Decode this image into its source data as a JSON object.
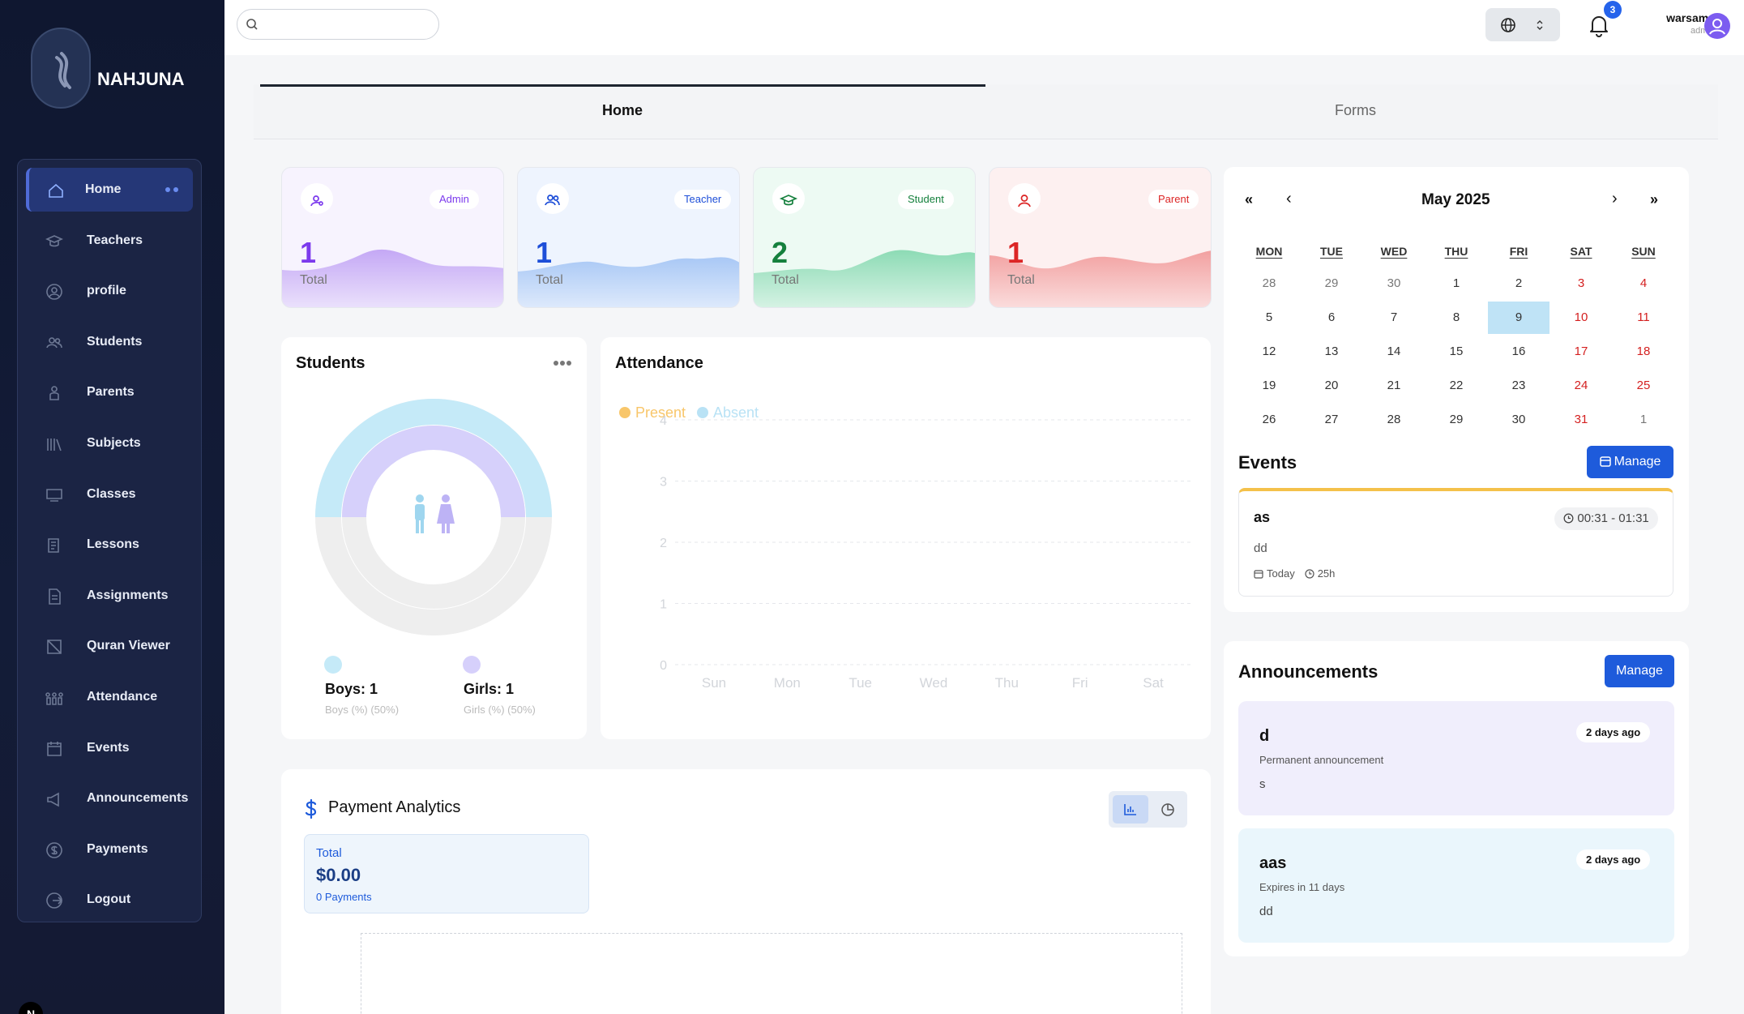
{
  "brand": {
    "name": "NAHJUNA"
  },
  "sidebar": {
    "items": [
      {
        "label": "Home",
        "icon": "home-icon"
      },
      {
        "label": "Teachers",
        "icon": "graduation-cap-icon"
      },
      {
        "label": "profile",
        "icon": "user-circle-icon"
      },
      {
        "label": "Students",
        "icon": "users-icon"
      },
      {
        "label": "Parents",
        "icon": "parent-icon"
      },
      {
        "label": "Subjects",
        "icon": "books-icon"
      },
      {
        "label": "Classes",
        "icon": "classroom-icon"
      },
      {
        "label": "Lessons",
        "icon": "notebook-icon"
      },
      {
        "label": "Assignments",
        "icon": "document-icon"
      },
      {
        "label": "Quran Viewer",
        "icon": "book-icon"
      },
      {
        "label": "Attendance",
        "icon": "attendance-icon"
      },
      {
        "label": "Events",
        "icon": "calendar-icon"
      },
      {
        "label": "Announcements",
        "icon": "megaphone-icon"
      },
      {
        "label": "Payments",
        "icon": "dollar-icon"
      },
      {
        "label": "Logout",
        "icon": "logout-icon"
      }
    ]
  },
  "corner_badge": "N",
  "topbar": {
    "search_placeholder": "",
    "notif_count": "3",
    "user_name": "warsame",
    "user_role": "admin"
  },
  "tabs": [
    {
      "label": "Home"
    },
    {
      "label": "Forms"
    }
  ],
  "stats": [
    {
      "role": "Admin",
      "value": "1",
      "total_label": "Total",
      "color": "#7c3aed"
    },
    {
      "role": "Teacher",
      "value": "1",
      "total_label": "Total",
      "color": "#1d4ed8"
    },
    {
      "role": "Student",
      "value": "2",
      "total_label": "Total",
      "color": "#15803d"
    },
    {
      "role": "Parent",
      "value": "1",
      "total_label": "Total",
      "color": "#dc2626"
    }
  ],
  "students": {
    "title": "Students",
    "boys": {
      "label": "Boys: 1",
      "sub": "Boys (%) (50%)",
      "value": 1,
      "color": "#c5eaf8"
    },
    "girls": {
      "label": "Girls: 1",
      "sub": "Girls (%) (50%)",
      "value": 1,
      "color": "#d6d0fb"
    }
  },
  "chart_data": {
    "type": "line",
    "title": "Attendance",
    "x": [
      "Sun",
      "Mon",
      "Tue",
      "Wed",
      "Thu",
      "Fri",
      "Sat"
    ],
    "yticks": [
      "0",
      "1",
      "2",
      "3",
      "4"
    ],
    "ylim": [
      0,
      4
    ],
    "grid": true,
    "legend_placement": "top-left",
    "series": [
      {
        "name": "Present",
        "color": "#f8c66a",
        "values": []
      },
      {
        "name": "Absent",
        "color": "#b9e2f5",
        "values": []
      }
    ]
  },
  "calendar": {
    "month": "May 2025",
    "nav": {
      "prev_year": "«",
      "prev": "‹",
      "next": "›",
      "next_year": "»"
    },
    "weekdays": [
      "MON",
      "TUE",
      "WED",
      "THU",
      "FRI",
      "SAT",
      "SUN"
    ],
    "weeks": [
      [
        "28",
        "29",
        "30",
        "1",
        "2",
        "3",
        "4"
      ],
      [
        "5",
        "6",
        "7",
        "8",
        "9",
        "10",
        "11"
      ],
      [
        "12",
        "13",
        "14",
        "15",
        "16",
        "17",
        "18"
      ],
      [
        "19",
        "20",
        "21",
        "22",
        "23",
        "24",
        "25"
      ],
      [
        "26",
        "27",
        "28",
        "29",
        "30",
        "31",
        "1"
      ]
    ],
    "selected": "9"
  },
  "events": {
    "title": "Events",
    "manage_label": "Manage",
    "item": {
      "name": "as",
      "time": "00:31 - 01:31",
      "desc": "dd",
      "day": "Today",
      "duration": "25h"
    }
  },
  "announcements": {
    "title": "Announcements",
    "manage_label": "Manage",
    "items": [
      {
        "title": "d",
        "age": "2 days ago",
        "meta": "Permanent announcement",
        "body": "s"
      },
      {
        "title": "aas",
        "age": "2 days ago",
        "meta": "Expires in 11 days",
        "body": "dd"
      }
    ]
  },
  "payments": {
    "title": "Payment Analytics",
    "total_label": "Total",
    "amount": "$0.00",
    "count": "0 Payments"
  }
}
